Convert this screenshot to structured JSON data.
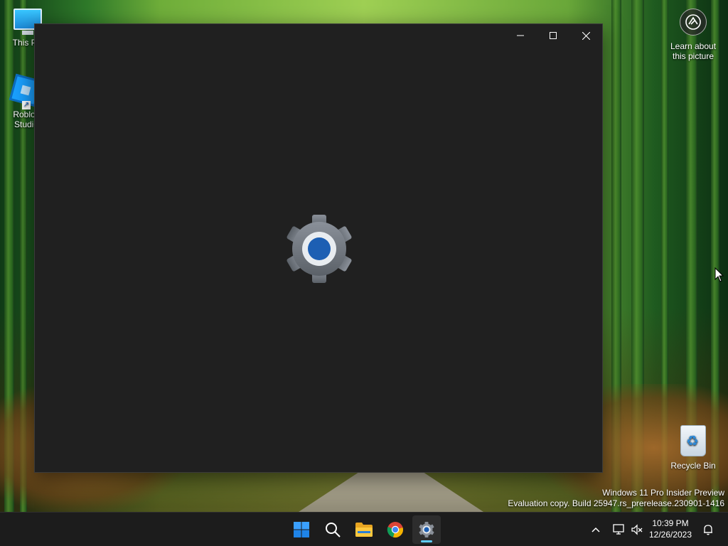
{
  "desktop": {
    "icons": [
      {
        "label": "This PC"
      },
      {
        "label": "Roblox Studio"
      },
      {
        "label": "Recycle Bin"
      }
    ],
    "learn_about": {
      "label": "Learn about this picture"
    },
    "watermark": {
      "line1": "Windows 11 Pro Insider Preview",
      "line2": "Evaluation copy. Build 25947.rs_prerelease.230901-1416"
    }
  },
  "window": {
    "app_icon": "settings-gear-icon",
    "controls": {
      "minimize": "minimize-icon",
      "maximize": "maximize-icon",
      "close": "close-icon"
    }
  },
  "taskbar": {
    "apps": [
      {
        "name": "start",
        "icon": "windows-logo-icon"
      },
      {
        "name": "search",
        "icon": "search-icon"
      },
      {
        "name": "file-explorer",
        "icon": "folder-icon"
      },
      {
        "name": "chrome",
        "icon": "chrome-icon"
      },
      {
        "name": "settings",
        "icon": "settings-gear-icon",
        "active": true
      }
    ],
    "tray": {
      "icons": [
        "chevron-up-icon",
        "network-icon",
        "volume-muted-icon",
        "notification-bell-icon"
      ]
    },
    "clock": {
      "time": "10:39 PM",
      "date": "12/26/2023"
    }
  },
  "colors": {
    "window_bg": "#202020",
    "taskbar_bg": "#1c1c1c",
    "accent": "#60cdff",
    "gear_blue": "#1d5fb3"
  }
}
